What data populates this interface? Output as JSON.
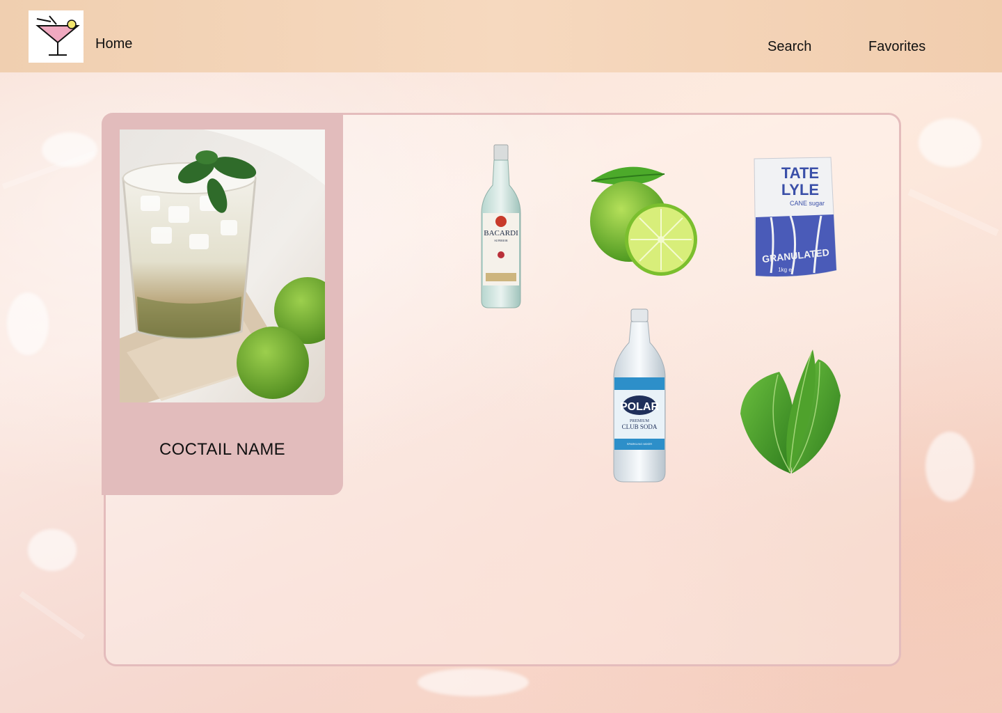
{
  "nav": {
    "home": "Home",
    "search": "Search",
    "favorites": "Favorites"
  },
  "logo_icon": "cocktail-glass-icon",
  "card": {
    "name": "COCTAIL NAME",
    "photo": "mojito-glass-image"
  },
  "ingredients": [
    {
      "icon": "rum-bottle-image",
      "brand": "BACARDI",
      "subtitle": "SUPERIOR"
    },
    {
      "icon": "lime-image"
    },
    {
      "icon": "sugar-bag-image",
      "brand_line1": "TATE",
      "brand_line2": "LYLE",
      "subtitle": "CANE sugar",
      "label": "GRANULATED",
      "weight": "1kg e"
    },
    {
      "icon": "soda-bottle-image",
      "brand": "POLAR",
      "subtitle1": "PREMIUM",
      "subtitle2": "CLUB SODA",
      "subtitle3": "SPARKLING MIXER"
    },
    {
      "icon": "mint-leaves-image"
    }
  ],
  "colors": {
    "header": "#f2d2b5",
    "card": "#e2bcbc",
    "panel_border": "#e4bcbc"
  }
}
